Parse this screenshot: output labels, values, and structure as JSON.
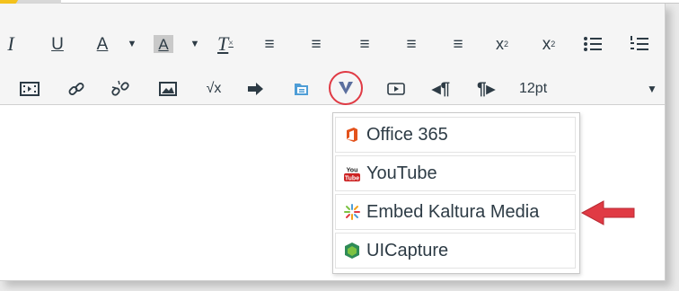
{
  "toolbar": {
    "row1": [
      "I",
      "U",
      "A",
      "A",
      "T",
      "≡",
      "≡",
      "≡",
      "≡",
      "≡",
      "x",
      "x",
      "≡",
      "≡"
    ],
    "superscript_label": "x",
    "subscript_label": "x",
    "sup_mark": "2",
    "sub_mark": "2",
    "font_size": "12pt"
  },
  "menu": {
    "items": [
      {
        "label": "Office 365",
        "icon": "office-365-icon"
      },
      {
        "label": "YouTube",
        "icon": "youtube-icon"
      },
      {
        "label": "Embed Kaltura Media",
        "icon": "kaltura-icon"
      },
      {
        "label": "UICapture",
        "icon": "uicapture-icon"
      }
    ]
  },
  "colors": {
    "accent_red": "#e03a44",
    "text": "#2d3b45",
    "kaltura_blue": "#4e9dd6"
  }
}
